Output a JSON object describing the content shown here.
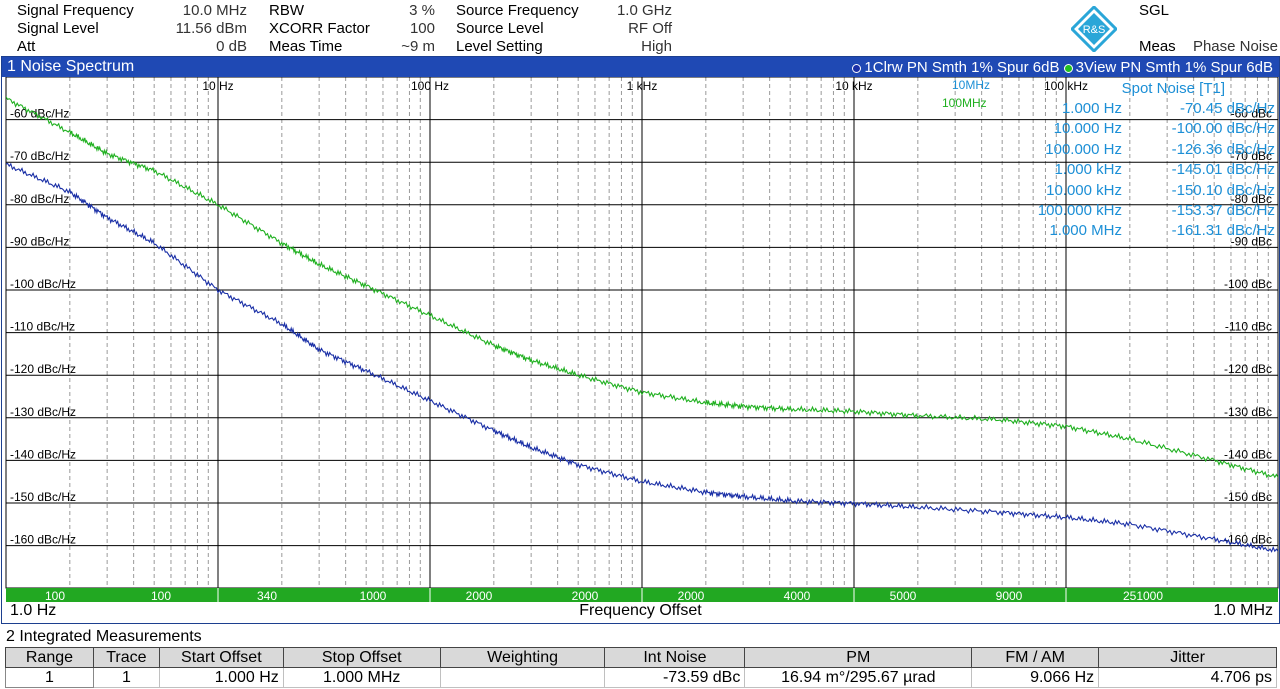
{
  "header": {
    "rows": [
      [
        {
          "label": "Signal Frequency",
          "value": "10.0 MHz"
        },
        {
          "label": "RBW",
          "value": "3 %"
        },
        {
          "label": "Source Frequency",
          "value": "1.0 GHz"
        }
      ],
      [
        {
          "label": "Signal Level",
          "value": "11.56 dBm"
        },
        {
          "label": "XCORR Factor",
          "value": "100"
        },
        {
          "label": "Source Level",
          "value": "RF Off"
        }
      ],
      [
        {
          "label": "Att",
          "value": "0 dB"
        },
        {
          "label": "Meas Time",
          "value": "~9 m"
        },
        {
          "label": "Level Setting",
          "value": "High"
        }
      ]
    ],
    "logo_text": "R&S",
    "mode": "SGL",
    "meas_label": "Meas",
    "meas_value": "Phase Noise"
  },
  "window1": {
    "title": "1 Noise Spectrum",
    "legend": [
      {
        "text": "1Clrw PN Smth 1% Spur 6dB",
        "color": "#1a2fa6"
      },
      {
        "text": "3View PN Smth 1% Spur 6dB",
        "color": "#20b020"
      }
    ],
    "marker_labels": [
      {
        "text": "10MHz",
        "color": "#1c8fd6"
      },
      {
        "text": "100MHz",
        "color": "#20b020"
      }
    ],
    "x_start": "1.0 Hz",
    "x_label": "Frequency Offset",
    "x_stop": "1.0 MHz",
    "band_values": [
      "100",
      "100",
      "340",
      "1000",
      "2000",
      "2000",
      "2000",
      "4000",
      "5000",
      "9000",
      "251000"
    ]
  },
  "chart_data": {
    "type": "line",
    "xscale": "log",
    "xlim": [
      1,
      1000000
    ],
    "ylim": [
      -165,
      -55
    ],
    "x_ticks": [
      "10 Hz",
      "100 Hz",
      "1 kHz",
      "10 kHz",
      "100 kHz"
    ],
    "y_ticks": [
      "-60 dBc/Hz",
      "-70 dBc/Hz",
      "-80 dBc/Hz",
      "-90 dBc/Hz",
      "-100 dBc/Hz",
      "-110 dBc/Hz",
      "-120 dBc/Hz",
      "-130 dBc/Hz",
      "-140 dBc/Hz",
      "-150 dBc/Hz",
      "-160 dBc/Hz"
    ],
    "y_ticks_right": [
      "-60 dBc",
      "-70 dBc",
      "-80 dBc",
      "-90 dBc",
      "-100 dBc",
      "-110 dBc",
      "-120 dBc",
      "-130 dBc",
      "-140 dBc",
      "-150 dBc",
      "-160 dBc"
    ],
    "y_tick_values": [
      -60,
      -70,
      -80,
      -90,
      -100,
      -110,
      -120,
      -130,
      -140,
      -150,
      -160
    ],
    "xlabel": "Frequency Offset",
    "ylabel": "",
    "grid": true,
    "series": [
      {
        "name": "1Clrw PN Smth 1% Spur 6dB",
        "color": "#1a2fa6",
        "x": [
          1,
          2,
          3,
          5,
          10,
          20,
          30,
          50,
          100,
          200,
          300,
          500,
          1000,
          2000,
          3000,
          5000,
          10000,
          20000,
          50000,
          100000,
          200000,
          500000,
          1000000
        ],
        "y": [
          -70.5,
          -77,
          -83,
          -89,
          -100,
          -108,
          -114,
          -119,
          -126,
          -133,
          -137,
          -141,
          -145,
          -147.5,
          -148.5,
          -149.5,
          -150.1,
          -151,
          -152.2,
          -153.4,
          -155,
          -158.5,
          -161.3
        ]
      },
      {
        "name": "3View PN Smth 1% Spur 6dB",
        "color": "#20b020",
        "x": [
          1,
          2,
          3,
          5,
          10,
          20,
          30,
          50,
          100,
          200,
          300,
          500,
          1000,
          2000,
          3000,
          5000,
          10000,
          20000,
          50000,
          100000,
          200000,
          500000,
          1000000
        ],
        "y": [
          -55,
          -63,
          -68,
          -72,
          -80,
          -89,
          -94,
          -99,
          -106,
          -113,
          -116.5,
          -120,
          -124,
          -126.5,
          -127.3,
          -128,
          -128.5,
          -129.5,
          -130.5,
          -132,
          -135,
          -140,
          -144
        ]
      }
    ]
  },
  "spot_noise": {
    "title": "Spot Noise [T1]",
    "rows": [
      {
        "freq": "1.000 Hz",
        "value": "-70.45 dBc/Hz"
      },
      {
        "freq": "10.000 Hz",
        "value": "-100.00 dBc/Hz"
      },
      {
        "freq": "100.000 Hz",
        "value": "-126.36 dBc/Hz"
      },
      {
        "freq": "1.000 kHz",
        "value": "-145.01 dBc/Hz"
      },
      {
        "freq": "10.000 kHz",
        "value": "-150.10 dBc/Hz"
      },
      {
        "freq": "100.000 kHz",
        "value": "-153.37 dBc/Hz"
      },
      {
        "freq": "1.000 MHz",
        "value": "-161.31 dBc/Hz"
      }
    ]
  },
  "window2": {
    "title": "2 Integrated Measurements",
    "columns": [
      "Range",
      "Trace",
      "Start Offset",
      "Stop Offset",
      "Weighting",
      "Int Noise",
      "PM",
      "FM / AM",
      "Jitter"
    ],
    "row": [
      "1",
      "1",
      "1.000 Hz",
      "1.000 MHz",
      "",
      "-73.59 dBc",
      "16.94 m°/295.67 µrad",
      "9.066 Hz",
      "4.706 ps"
    ]
  }
}
